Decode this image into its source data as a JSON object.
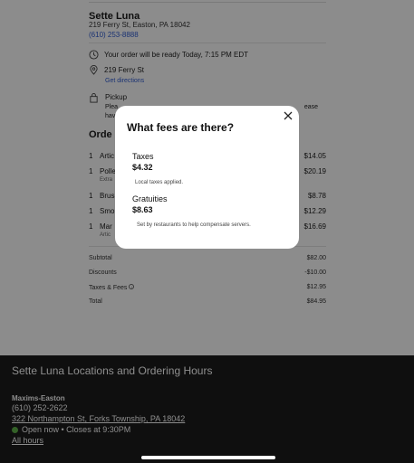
{
  "restaurant": {
    "name": "Sette Luna",
    "address": "219 Ferry St, Easton, PA 18042",
    "phone": "(610) 253-8888"
  },
  "pickup_info": {
    "ready_text": "Your order will be ready Today, 7:15 PM EDT",
    "location_text": "219 Ferry St",
    "directions_link": "Get directions",
    "pickup_label": "Pickup",
    "pickup_note_line1": "Plea",
    "pickup_note_line1_end": "ease",
    "pickup_note_line2": "hav"
  },
  "order": {
    "title": "Orde",
    "items": [
      {
        "qty": "1",
        "name": "Artic",
        "extra": "",
        "price": "$14.05"
      },
      {
        "qty": "1",
        "name": "Polle",
        "extra": "Extra",
        "price": "$20.19"
      },
      {
        "qty": "1",
        "name": "Brus",
        "extra": "",
        "price": "$8.78"
      },
      {
        "qty": "1",
        "name": "Smo",
        "extra": "",
        "price": "$12.29"
      },
      {
        "qty": "1",
        "name": "Mar",
        "extra": "Artic",
        "price": "$16.69"
      }
    ]
  },
  "summary": {
    "subtotal_label": "Subtotal",
    "subtotal_value": "$82.00",
    "discounts_label": "Discounts",
    "discounts_value": "-$10.00",
    "taxes_fees_label": "Taxes & Fees",
    "taxes_fees_value": "$12.95",
    "total_label": "Total",
    "total_value": "$84.95"
  },
  "footer": {
    "title": "Sette Luna Locations and Ordering Hours",
    "location_name": "Maxims-Easton",
    "phone": "(610) 252-2622",
    "address": "322 Northampton St, Forks Township, PA 18042",
    "open_status": "Open now • Closes at 9:30PM",
    "all_hours": "All hours"
  },
  "modal": {
    "title": "What fees are there?",
    "taxes_label": "Taxes",
    "taxes_amount": "$4.32",
    "taxes_note": "Local taxes applied.",
    "gratuities_label": "Gratuities",
    "gratuities_amount": "$8.63",
    "gratuities_note": "Set by restaurants to help compensate servers."
  },
  "colors": {
    "link": "#2f5bd1",
    "footer_bg": "#1c1c1c",
    "open_dot": "#5fb24a"
  },
  "icons": {
    "clock": "clock-icon",
    "location": "location-pin-icon",
    "pickup": "bag-icon",
    "close": "close-icon",
    "info": "info-icon"
  }
}
